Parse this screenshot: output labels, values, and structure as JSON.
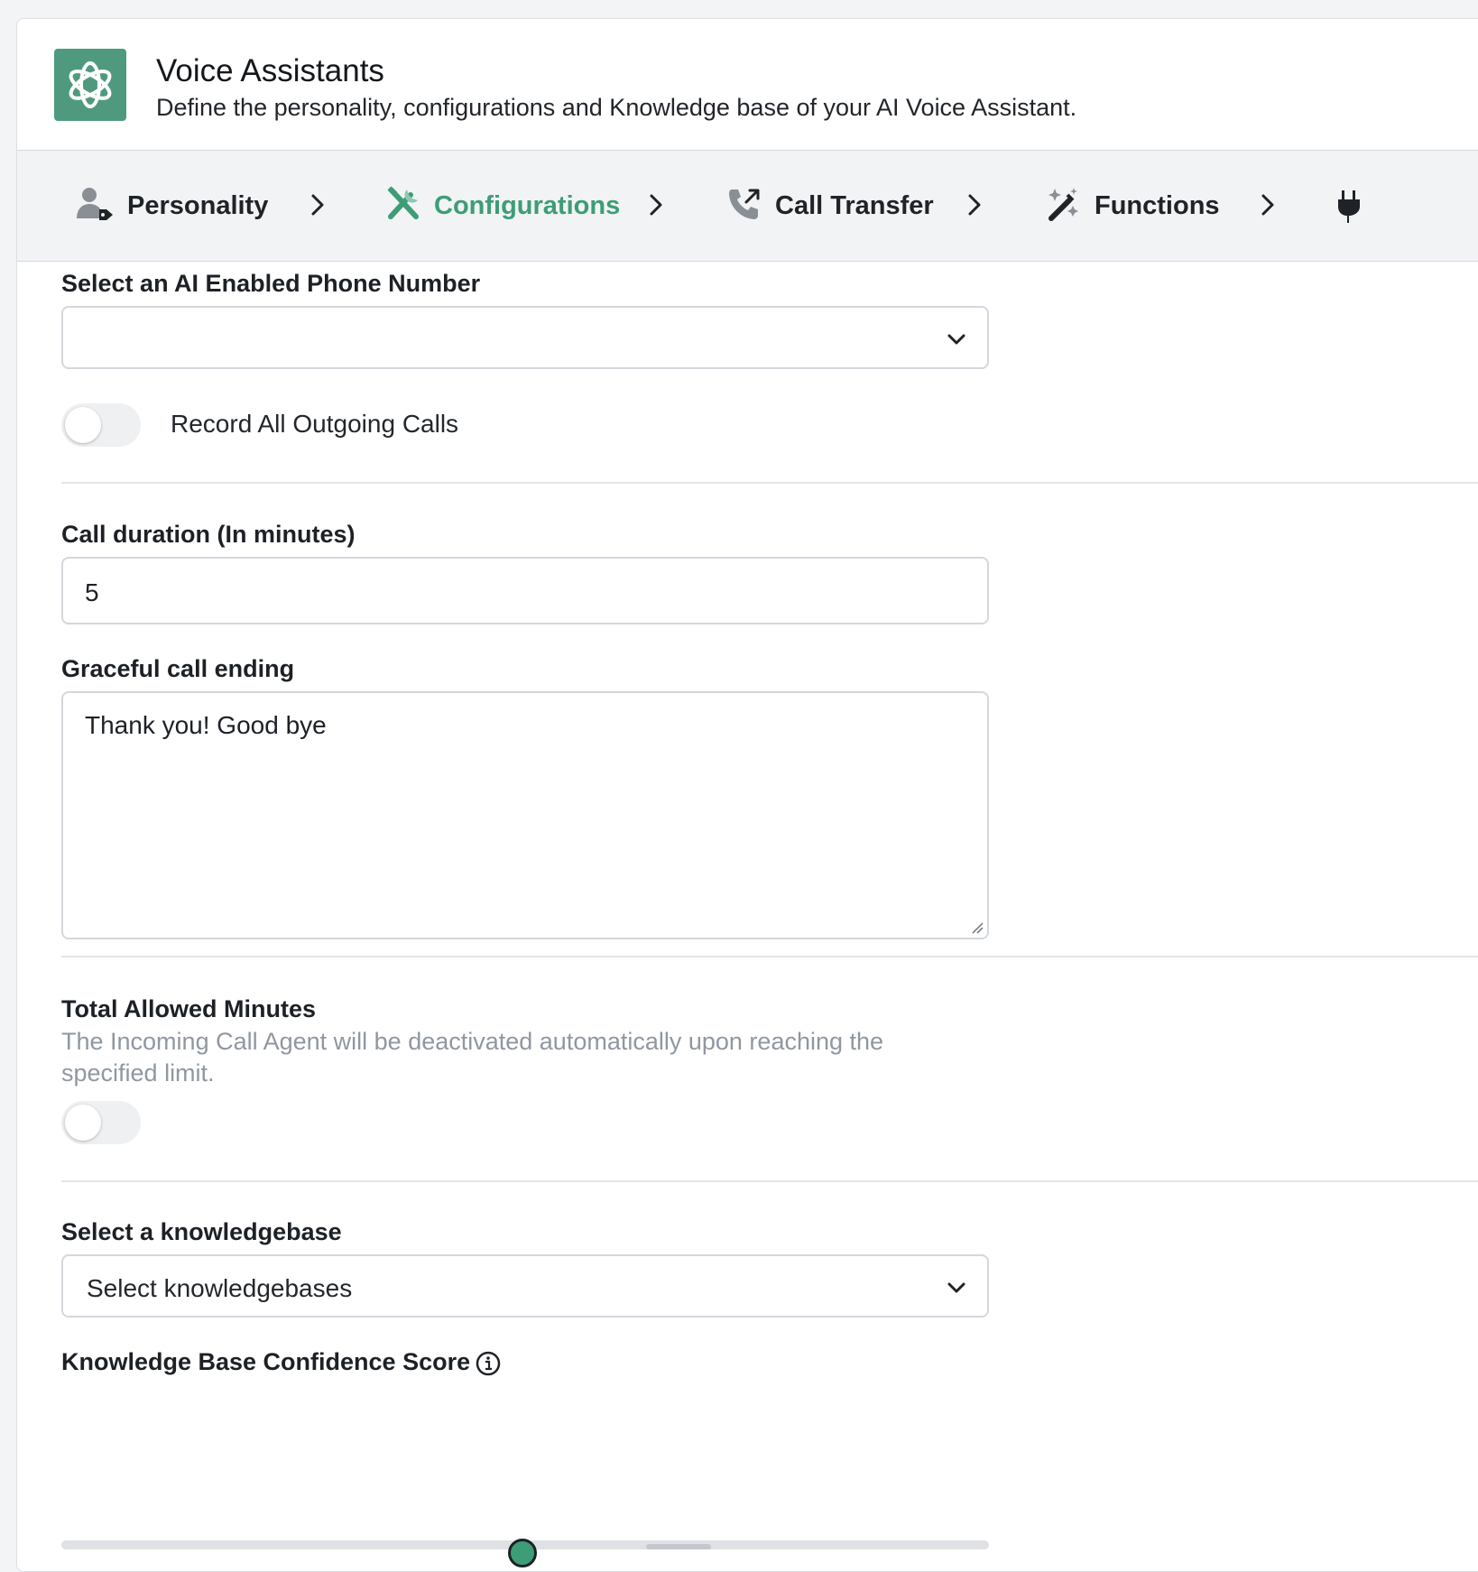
{
  "header": {
    "title": "Voice Assistants",
    "subtitle": "Define the personality, configurations and Knowledge base of your AI Voice Assistant."
  },
  "steps": [
    {
      "label": "Personality",
      "icon": "user-tag-icon",
      "active": false
    },
    {
      "label": "Configurations",
      "icon": "tools-icon",
      "active": true
    },
    {
      "label": "Call Transfer",
      "icon": "phone-forward-icon",
      "active": false
    },
    {
      "label": "Functions",
      "icon": "magic-wand-icon",
      "active": false
    }
  ],
  "colors": {
    "accent": "#3d9d77",
    "logo_bg": "#4f9a7f"
  },
  "form": {
    "phone_number": {
      "label": "Select an AI Enabled Phone Number",
      "value": ""
    },
    "record_calls": {
      "label": "Record All Outgoing Calls",
      "enabled": false
    },
    "call_duration": {
      "label": "Call duration (In minutes)",
      "value": "5"
    },
    "graceful_ending": {
      "label": "Graceful call ending",
      "value": "Thank you! Good bye"
    },
    "total_minutes": {
      "label": "Total Allowed Minutes",
      "help": "The Incoming Call Agent will be deactivated automatically upon reaching the specified limit.",
      "enabled": false
    },
    "knowledgebase": {
      "label": "Select a knowledgebase",
      "placeholder": "Select knowledgebases"
    },
    "confidence": {
      "label": "Knowledge Base Confidence Score",
      "icon": "info-circle-icon"
    }
  }
}
